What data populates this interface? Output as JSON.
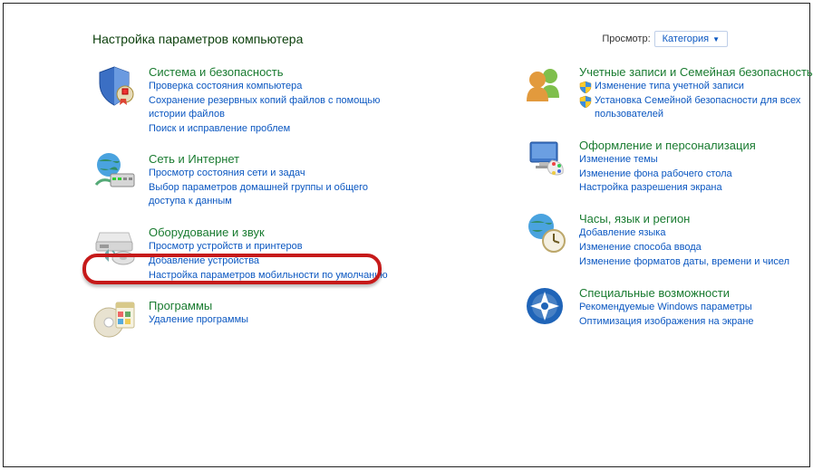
{
  "header": {
    "title": "Настройка параметров компьютера",
    "view_label": "Просмотр:",
    "view_value": "Категория"
  },
  "left": [
    {
      "key": "system",
      "title": "Система и безопасность",
      "links": [
        {
          "text": "Проверка состояния компьютера",
          "shield": false
        },
        {
          "text": "Сохранение резервных копий файлов с помощью истории файлов",
          "shield": false
        },
        {
          "text": "Поиск и исправление проблем",
          "shield": false
        }
      ]
    },
    {
      "key": "network",
      "title": "Сеть и Интернет",
      "links": [
        {
          "text": "Просмотр состояния сети и задач",
          "shield": false
        },
        {
          "text": "Выбор параметров домашней группы и общего доступа к данным",
          "shield": false
        }
      ]
    },
    {
      "key": "hardware",
      "title": "Оборудование и звук",
      "links": [
        {
          "text": "Просмотр устройств и принтеров",
          "shield": false
        },
        {
          "text": "Добавление устройства",
          "shield": false
        },
        {
          "text": "Настройка параметров мобильности по умолчанию",
          "shield": false
        }
      ]
    },
    {
      "key": "programs",
      "title": "Программы",
      "links": [
        {
          "text": "Удаление программы",
          "shield": false
        }
      ]
    }
  ],
  "right": [
    {
      "key": "users",
      "title": "Учетные записи и Семейная безопасность",
      "links": [
        {
          "text": "Изменение типа учетной записи",
          "shield": true
        },
        {
          "text": "Установка Семейной безопасности для всех пользователей",
          "shield": true
        }
      ]
    },
    {
      "key": "appearance",
      "title": "Оформление и персонализация",
      "links": [
        {
          "text": "Изменение темы",
          "shield": false
        },
        {
          "text": "Изменение фона рабочего стола",
          "shield": false
        },
        {
          "text": "Настройка разрешения экрана",
          "shield": false
        }
      ]
    },
    {
      "key": "clock",
      "title": "Часы, язык и регион",
      "links": [
        {
          "text": "Добавление языка",
          "shield": false
        },
        {
          "text": "Изменение способа ввода",
          "shield": false
        },
        {
          "text": "Изменение форматов даты, времени и чисел",
          "shield": false
        }
      ]
    },
    {
      "key": "ease",
      "title": "Специальные возможности",
      "links": [
        {
          "text": "Рекомендуемые Windows параметры",
          "shield": false
        },
        {
          "text": "Оптимизация изображения на экране",
          "shield": false
        }
      ]
    }
  ]
}
